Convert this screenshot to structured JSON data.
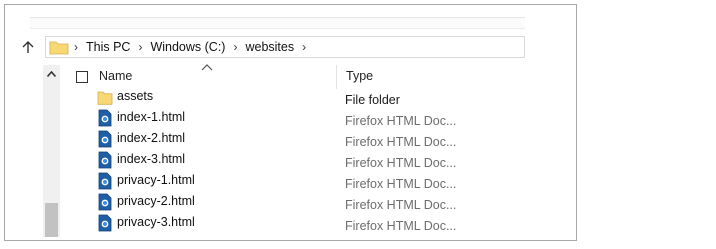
{
  "address": {
    "crumbs": [
      "This PC",
      "Windows (C:)",
      "websites"
    ]
  },
  "columns": {
    "name": "Name",
    "type": "Type"
  },
  "files": [
    {
      "name": "assets",
      "type": "File folder",
      "kind": "folder",
      "icon": "folder-icon"
    },
    {
      "name": "index-1.html",
      "type": "Firefox HTML Doc...",
      "kind": "file",
      "icon": "firefox-html-icon"
    },
    {
      "name": "index-2.html",
      "type": "Firefox HTML Doc...",
      "kind": "file",
      "icon": "firefox-html-icon"
    },
    {
      "name": "index-3.html",
      "type": "Firefox HTML Doc...",
      "kind": "file",
      "icon": "firefox-html-icon"
    },
    {
      "name": "privacy-1.html",
      "type": "Firefox HTML Doc...",
      "kind": "file",
      "icon": "firefox-html-icon"
    },
    {
      "name": "privacy-2.html",
      "type": "Firefox HTML Doc...",
      "kind": "file",
      "icon": "firefox-html-icon"
    },
    {
      "name": "privacy-3.html",
      "type": "Firefox HTML Doc...",
      "kind": "file",
      "icon": "firefox-html-icon"
    }
  ],
  "colors": {
    "folder_yellow": "#f8d775",
    "html_icon_blue": "#1f5fa8",
    "type_text_gray": "#6d6d6d"
  }
}
